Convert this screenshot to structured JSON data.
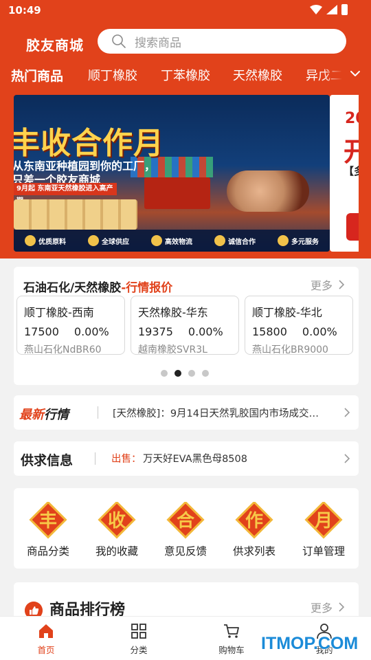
{
  "status_bar": {
    "time": "10:49"
  },
  "header": {
    "app_title": "胶友商城",
    "search_placeholder": "搜索商品",
    "tabs": [
      {
        "label": "热门商品",
        "active": true
      },
      {
        "label": "顺丁橡胶"
      },
      {
        "label": "丁苯橡胶"
      },
      {
        "label": "天然橡胶"
      },
      {
        "label": "异戊二"
      }
    ]
  },
  "banner": {
    "headline": "丰收合作月",
    "sub_line_1": "从东南亚种植园到你的工厂，",
    "sub_line_2": "只差一个胶友商城",
    "ribbon": "9月起 东南亚天然橡胶进入高产期",
    "features": [
      "优质原料",
      "全球供应",
      "高效物流",
      "诚信合作",
      "多元服务"
    ],
    "next_year": "20",
    "next_big": "开",
    "next_small": "【多"
  },
  "quote": {
    "title_main": "石油石化/天然橡胶",
    "title_highlight": "-行情报价",
    "more": "更多",
    "items": [
      {
        "name": "顺丁橡胶-西南",
        "price": "17500",
        "change": "0.00%",
        "brand": "燕山石化NdBR60"
      },
      {
        "name": "天然橡胶-华东",
        "price": "19375",
        "change": "0.00%",
        "brand": "越南橡胶SVR3L"
      },
      {
        "name": "顺丁橡胶-华北",
        "price": "15800",
        "change": "0.00%",
        "brand": "燕山石化BR9000"
      }
    ],
    "page_index": 2,
    "page_count": 4
  },
  "news": {
    "logo_red": "最新",
    "logo_dark": "行情",
    "text": "[天然橡胶]：9月14日天然乳胶国内市场成交…"
  },
  "supply": {
    "title": "供求信息",
    "type_label": "出售：",
    "text": "万天好EVA黑色母8508"
  },
  "menu": [
    {
      "char": "丰",
      "label": "商品分类"
    },
    {
      "char": "收",
      "label": "我的收藏"
    },
    {
      "char": "合",
      "label": "意见反馈"
    },
    {
      "char": "作",
      "label": "供求列表"
    },
    {
      "char": "月",
      "label": "订单管理"
    }
  ],
  "ranking": {
    "title": "商品排行榜",
    "more": "更多"
  },
  "bottom_nav": [
    {
      "label": "首页",
      "icon": "home-icon",
      "active": true
    },
    {
      "label": "分类",
      "icon": "grid-icon"
    },
    {
      "label": "购物车",
      "icon": "cart-icon"
    },
    {
      "label": "我的",
      "icon": "user-icon"
    }
  ],
  "watermark": "ITMOP.COM",
  "colors": {
    "accent": "#e1421b",
    "watermark": "#1b8bd8"
  }
}
